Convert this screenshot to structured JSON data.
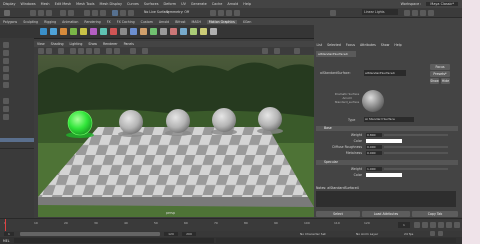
{
  "menubar": {
    "items": [
      "Display",
      "Windows",
      "Mesh",
      "Edit Mesh",
      "Mesh Tools",
      "Mesh Display",
      "Curves",
      "Surfaces",
      "Deform",
      "UV",
      "Generate",
      "Cache",
      "Arnold",
      "Help"
    ],
    "workspace_label": "Workspace :",
    "workspace_value": "Maya Classic*"
  },
  "toolbar": {
    "live_surface": "No Live Surface",
    "symmetry": "Symmetry: Off",
    "layout": "Linear Lights"
  },
  "shelf_tabs": [
    "Polygons",
    "Sculpting",
    "Rigging",
    "Animation",
    "Rendering",
    "FX",
    "FX Caching",
    "Custom",
    "Arnold",
    "Bifrost",
    "MASH",
    "Motion Graphics",
    "XGen"
  ],
  "shelf_active": "Motion Graphics",
  "viewport": {
    "menus": [
      "View",
      "Shading",
      "Lighting",
      "Show",
      "Renderer",
      "Panels"
    ],
    "camera_label": "persp",
    "colors": {
      "selected": "#31e63a",
      "sphere": "#bcbcbc"
    }
  },
  "attribute_editor": {
    "tabs": [
      "List",
      "Selected",
      "Focus",
      "Attributes",
      "Show",
      "Help"
    ],
    "node_tab": "aiStandardSurface4",
    "type_label": "aiStandardSurface:",
    "node_name": "aiStandardSurface4",
    "focus_label": "Focus",
    "presets_label": "Presets*",
    "show_label": "Show",
    "hide_label": "Hide",
    "swatch_caption": "Dramatic Surface Arnold Standard_surface",
    "type_row_label": "Type",
    "type_value": "Ai Standard Surface",
    "sections": {
      "base": "Base",
      "specular": "Specular"
    },
    "base_attrs": [
      {
        "label": "Weight",
        "value": "0.800"
      },
      {
        "label": "Color",
        "value": ""
      },
      {
        "label": "Diffuse Roughness",
        "value": "0.000"
      },
      {
        "label": "Metalness",
        "value": "0.000"
      }
    ],
    "specular_attrs": [
      {
        "label": "Weight",
        "value": "1.000"
      },
      {
        "label": "Color",
        "value": ""
      }
    ],
    "notes_label": "Notes: aiStandardSurface4",
    "buttons": {
      "select": "Select",
      "load": "Load Attributes",
      "copy": "Copy Tab"
    }
  },
  "timeline": {
    "ticks": [
      "1",
      "10",
      "20",
      "30",
      "40",
      "50",
      "60",
      "70",
      "80",
      "90",
      "100",
      "110",
      "120"
    ],
    "start": "1",
    "end": "120",
    "range_end": "200",
    "no_character_set": "No Character Set",
    "no_anim_layer": "No Anim Layer",
    "fps": "24 fps"
  },
  "cmdline": {
    "label": "MEL"
  }
}
